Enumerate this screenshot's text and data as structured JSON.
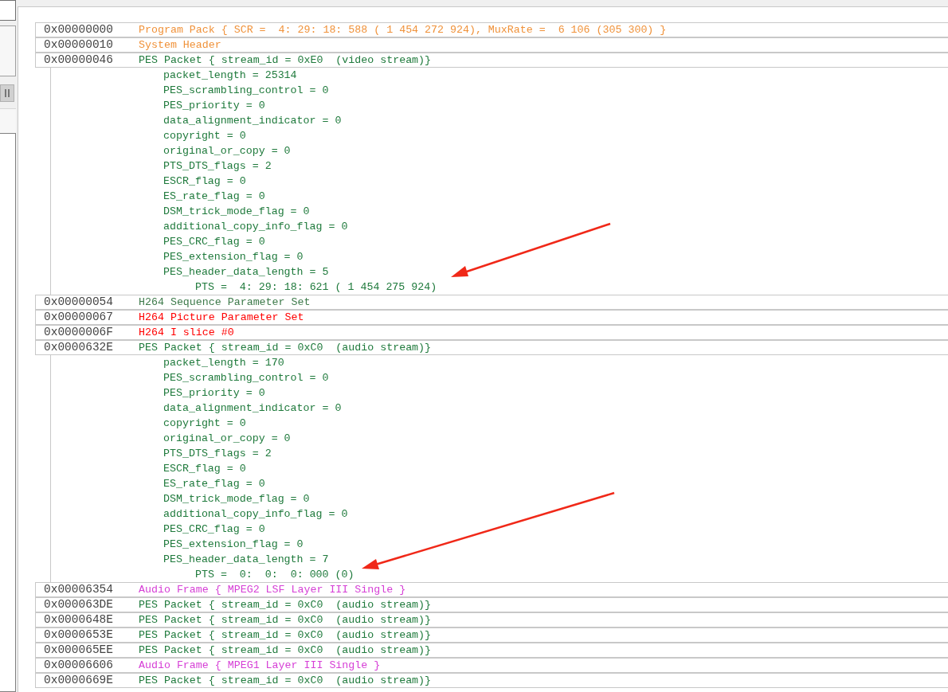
{
  "packets": [
    {
      "address": "0x00000000",
      "text": "Program Pack { SCR =  4: 29: 18: 588 ( 1 454 272 924), MuxRate =  6 106 (305 300) }",
      "color": "#f0923a"
    },
    {
      "address": "0x00000010",
      "text": "System Header",
      "color": "#f0923a"
    },
    {
      "address": "0x00000046",
      "text": "PES Packet { stream_id = 0xE0  (video stream)}",
      "color": "#1f7a3c",
      "children": [
        {
          "kind": "field",
          "text": "packet_length = 25314"
        },
        {
          "kind": "field",
          "text": "PES_scrambling_control = 0"
        },
        {
          "kind": "field",
          "text": "PES_priority = 0"
        },
        {
          "kind": "field",
          "text": "data_alignment_indicator = 0"
        },
        {
          "kind": "field",
          "text": "copyright = 0"
        },
        {
          "kind": "field",
          "text": "original_or_copy = 0"
        },
        {
          "kind": "field",
          "text": "PTS_DTS_flags = 2"
        },
        {
          "kind": "field",
          "text": "ESCR_flag = 0"
        },
        {
          "kind": "field",
          "text": "ES_rate_flag = 0"
        },
        {
          "kind": "field",
          "text": "DSM_trick_mode_flag = 0"
        },
        {
          "kind": "field",
          "text": "additional_copy_info_flag = 0"
        },
        {
          "kind": "field",
          "text": "PES_CRC_flag = 0"
        },
        {
          "kind": "field",
          "text": "PES_extension_flag = 0"
        },
        {
          "kind": "field",
          "text": "PES_header_data_length = 5"
        },
        {
          "kind": "timestamp",
          "text": "PTS =  4: 29: 18: 621 ( 1 454 275 924)"
        }
      ]
    },
    {
      "address": "0x00000054",
      "text": "H264 Sequence Parameter Set",
      "color": "#3d7a4a"
    },
    {
      "address": "0x00000067",
      "text": "H264 Picture Parameter Set",
      "color": "#ff0000"
    },
    {
      "address": "0x0000006F",
      "text": "H264 I slice #0",
      "color": "#ff0000"
    },
    {
      "address": "0x0000632E",
      "text": "PES Packet { stream_id = 0xC0  (audio stream)}",
      "color": "#1f7a3c",
      "children": [
        {
          "kind": "field",
          "text": "packet_length = 170"
        },
        {
          "kind": "field",
          "text": "PES_scrambling_control = 0"
        },
        {
          "kind": "field",
          "text": "PES_priority = 0"
        },
        {
          "kind": "field",
          "text": "data_alignment_indicator = 0"
        },
        {
          "kind": "field",
          "text": "copyright = 0"
        },
        {
          "kind": "field",
          "text": "original_or_copy = 0"
        },
        {
          "kind": "field",
          "text": "PTS_DTS_flags = 2"
        },
        {
          "kind": "field",
          "text": "ESCR_flag = 0"
        },
        {
          "kind": "field",
          "text": "ES_rate_flag = 0"
        },
        {
          "kind": "field",
          "text": "DSM_trick_mode_flag = 0"
        },
        {
          "kind": "field",
          "text": "additional_copy_info_flag = 0"
        },
        {
          "kind": "field",
          "text": "PES_CRC_flag = 0"
        },
        {
          "kind": "field",
          "text": "PES_extension_flag = 0"
        },
        {
          "kind": "field",
          "text": "PES_header_data_length = 7"
        },
        {
          "kind": "timestamp",
          "text": "PTS =  0:  0:  0: 000 (0)"
        }
      ]
    },
    {
      "address": "0x00006354",
      "text": "Audio Frame { MPEG2 LSF Layer III Single }",
      "color": "#d63fd6"
    },
    {
      "address": "0x000063DE",
      "text": "PES Packet { stream_id = 0xC0  (audio stream)}",
      "color": "#1f7a3c"
    },
    {
      "address": "0x0000648E",
      "text": "PES Packet { stream_id = 0xC0  (audio stream)}",
      "color": "#1f7a3c"
    },
    {
      "address": "0x0000653E",
      "text": "PES Packet { stream_id = 0xC0  (audio stream)}",
      "color": "#1f7a3c"
    },
    {
      "address": "0x000065EE",
      "text": "PES Packet { stream_id = 0xC0  (audio stream)}",
      "color": "#1f7a3c"
    },
    {
      "address": "0x00006606",
      "text": "Audio Frame { MPEG1 Layer III Single }",
      "color": "#d63fd6"
    },
    {
      "address": "0x0000669E",
      "text": "PES Packet { stream_id = 0xC0  (audio stream)}",
      "color": "#1f7a3c"
    }
  ]
}
